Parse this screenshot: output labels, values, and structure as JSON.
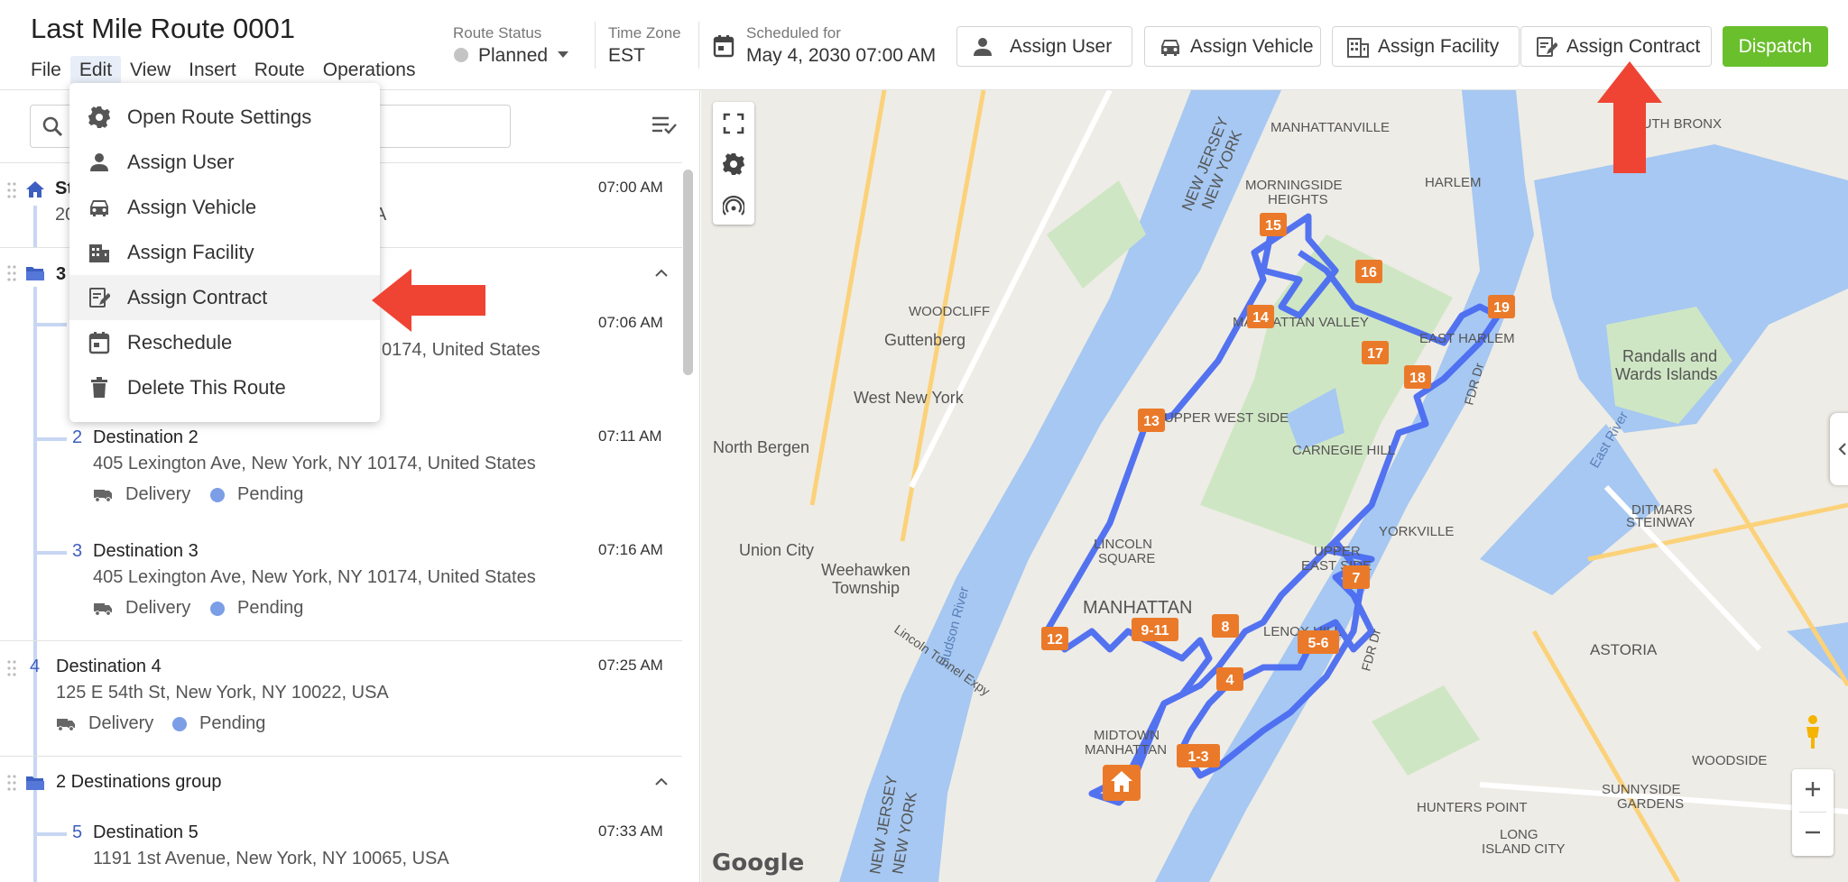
{
  "header": {
    "title": "Last Mile Route 0001",
    "menu": [
      "File",
      "Edit",
      "View",
      "Insert",
      "Route",
      "Operations"
    ],
    "route_status_label": "Route Status",
    "route_status_value": "Planned",
    "timezone_label": "Time Zone",
    "timezone_value": "EST",
    "scheduled_label": "Scheduled for",
    "scheduled_value": "May 4, 2030 07:00 AM",
    "buttons": {
      "assign_user": "Assign User",
      "assign_vehicle": "Assign Vehicle",
      "assign_facility": "Assign Facility",
      "assign_contract": "Assign Contract",
      "dispatch": "Dispatch"
    }
  },
  "edit_menu": {
    "items": [
      {
        "label": "Open Route Settings",
        "icon": "gear-icon"
      },
      {
        "label": "Assign User",
        "icon": "user-icon"
      },
      {
        "label": "Assign Vehicle",
        "icon": "car-icon"
      },
      {
        "label": "Assign Facility",
        "icon": "building-icon"
      },
      {
        "label": "Assign Contract",
        "icon": "contract-icon"
      },
      {
        "label": "Reschedule",
        "icon": "calendar-icon"
      },
      {
        "label": "Delete This Route",
        "icon": "trash-icon"
      }
    ]
  },
  "stops": {
    "start": {
      "name": "St",
      "address": "20",
      "address_tail": "A",
      "time": "07:00 AM"
    },
    "group1": {
      "title": "3",
      "stop1_time": "07:06 AM",
      "stop1_address_tail": "0174, United States"
    },
    "dest2": {
      "num": "2",
      "name": "Destination 2",
      "address": "405 Lexington Ave, New York, NY 10174, United States",
      "time": "07:11 AM",
      "type": "Delivery",
      "status": "Pending"
    },
    "dest3": {
      "num": "3",
      "name": "Destination 3",
      "address": "405 Lexington Ave, New York, NY 10174, United States",
      "time": "07:16 AM",
      "type": "Delivery",
      "status": "Pending"
    },
    "dest4": {
      "num": "4",
      "name": "Destination 4",
      "address": "125 E 54th St, New York, NY 10022, USA",
      "time": "07:25 AM",
      "type": "Delivery",
      "status": "Pending"
    },
    "group2": {
      "title": "2 Destinations group"
    },
    "dest5": {
      "num": "5",
      "name": "Destination 5",
      "address": "1191 1st Avenue, New York, NY 10065, USA",
      "time": "07:33 AM"
    }
  },
  "map": {
    "markers": [
      "15",
      "16",
      "14",
      "17",
      "18",
      "19",
      "13",
      "12",
      "9-11",
      "8",
      "7",
      "5-6",
      "4",
      "1-3"
    ],
    "labels": {
      "manhattanville": "MANHATTANVILLE",
      "harlem": "HARLEM",
      "morningside": "MORNINGSIDE",
      "heights": "HEIGHTS",
      "south_bronx": "SOUTH BRONX",
      "nj_ny_1": "NEW JERSEY",
      "nj_ny_2": "NEW YORK",
      "woodcliff": "WOODCLIFF",
      "guttenberg": "Guttenberg",
      "west_new_york": "West New York",
      "north_bergen": "North Bergen",
      "manhattan_valley": "MANHATTAN VALLEY",
      "east_harlem": "EAST HARLEM",
      "randalls": "Randalls and",
      "wards": "Wards Islands",
      "upper_west_side": "UPPER WEST SIDE",
      "carnegie_hill": "CARNEGIE HILL",
      "yorkville": "YORKVILLE",
      "ditmars": "DITMARS",
      "steinway": "STEINWAY",
      "lincoln": "LINCOLN",
      "square": "SQUARE",
      "upper_east": "UPPER",
      "east_side": "EAST SIDE",
      "union_city": "Union City",
      "weehawken": "Weehawken",
      "township": "Township",
      "manhattan": "MANHATTAN",
      "lenox_hill": "LENOX HILL",
      "astoria": "ASTORIA",
      "midtown": "MIDTOWN",
      "midtown2": "MANHATTAN",
      "hunters_point": "HUNTERS POINT",
      "woodside": "WOODSIDE",
      "sunnyside": "SUNNYSIDE",
      "gardens": "GARDENS",
      "long_island": "LONG",
      "island_city": "ISLAND CITY",
      "hudson_river": "Hudson River",
      "east_river": "East River",
      "nj_lower": "NEW JERSEY",
      "ny_lower": "NEW YORK",
      "lincoln_tunnel": "Lincoln Tunnel Expy",
      "fdr1": "FDR Dr",
      "fdr2": "FDR Dr",
      "google": "Google"
    }
  },
  "colors": {
    "dispatch": "#6abf2c",
    "route_line": "#4a6cf0",
    "marker": "#ea7a2a",
    "arrow": "#ef4433",
    "link_blue": "#3e5fc2"
  }
}
